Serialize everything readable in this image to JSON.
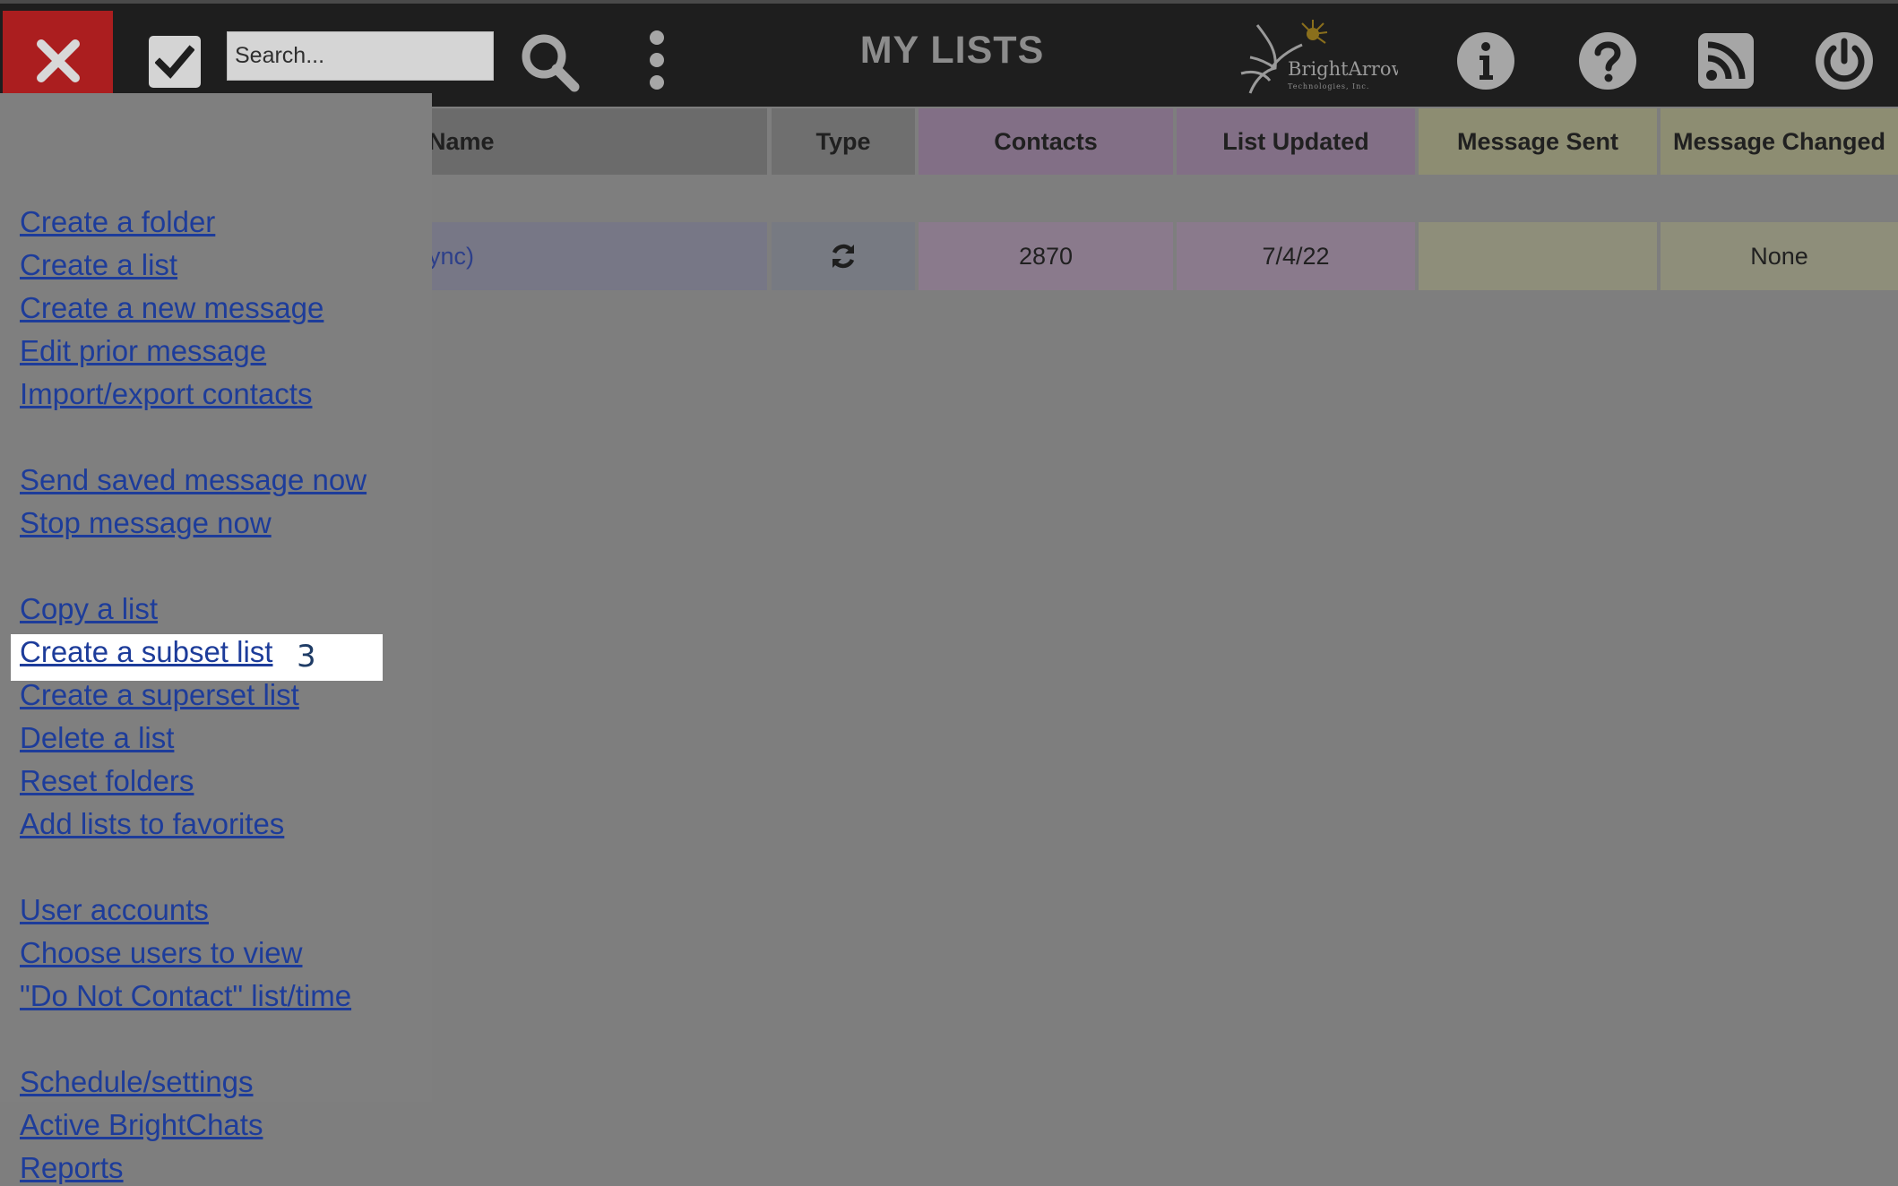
{
  "header": {
    "title": "MY LISTS",
    "search_placeholder": "Search...",
    "logo_text": "BrightArrow",
    "logo_subtext": "Technologies, Inc.",
    "close_icon": "close-icon",
    "check_icon": "checkmark-icon",
    "search_icon": "search-icon",
    "more_icon": "more-vertical-icon",
    "icons": [
      "info-icon",
      "help-icon",
      "rss-icon",
      "power-icon"
    ]
  },
  "table": {
    "columns": [
      "Name",
      "Type",
      "Contacts",
      "List Updated",
      "Message Sent",
      "Message Changed"
    ],
    "rows": [
      {
        "name": "ync)",
        "type_icon": "sync-icon",
        "contacts": "2870",
        "list_updated": "7/4/22",
        "message_sent": "",
        "message_changed": "None"
      }
    ]
  },
  "menu": {
    "items": [
      "Create a folder",
      "Create a list",
      "Create a new message",
      "Edit prior message",
      "Import/export contacts",
      "Send saved message now",
      "Stop message now",
      "Copy a list",
      "Create a subset list",
      "Create a superset list",
      "Delete a list",
      "Reset folders",
      "Add lists to favorites",
      "User accounts",
      "Choose users to view",
      "\"Do Not Contact\" list/time",
      "Schedule/settings",
      "Active BrightChats",
      "Reports"
    ],
    "highlighted_item": "Create a subset list",
    "step_badge": "3"
  },
  "colors": {
    "header_bg": "#1e1e1e",
    "close_button": "#ab1e1f",
    "link": "#1d3c9a",
    "purple_column": "#8a7a8c",
    "olive_column": "#8e8e7a",
    "highlight": "#ffffff"
  }
}
